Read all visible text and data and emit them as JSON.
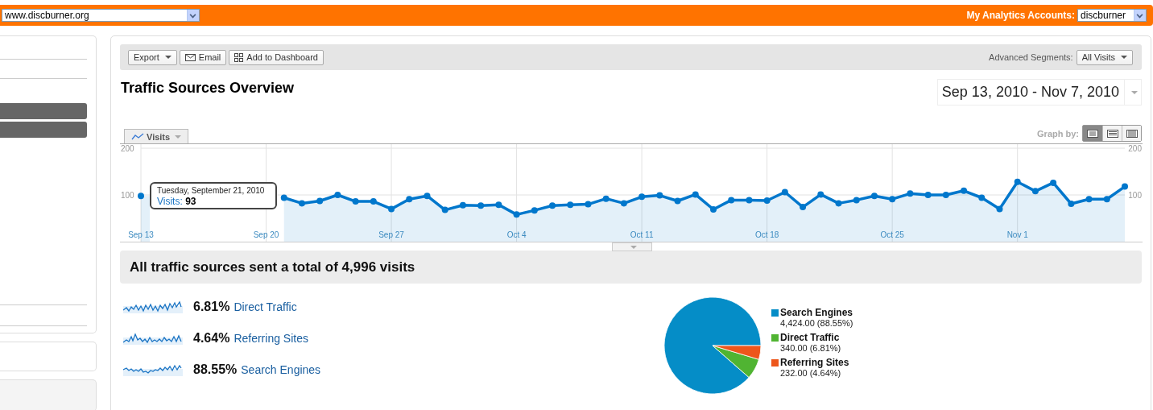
{
  "header": {
    "site_select": "www.discburner.org",
    "accounts_label": "My Analytics Accounts:",
    "account_select": "discburner"
  },
  "toolbar": {
    "buttons": [
      {
        "kind": "export",
        "label": "Export"
      },
      {
        "kind": "email",
        "label": "Email"
      },
      {
        "kind": "dashboard",
        "label": "Add to Dashboard"
      }
    ],
    "segments_label": "Advanced Segments:",
    "segments_select": "All Visits"
  },
  "title": "Traffic Sources Overview",
  "date_range": "Sep 13, 2010 - Nov 7, 2010",
  "graph": {
    "graph_by_label": "Graph by:",
    "graph_by": [
      {
        "selected": true
      },
      {
        "selected": false
      },
      {
        "selected": false
      }
    ],
    "tooltip": {
      "date": "Tuesday, September 21, 2010",
      "label": "Visits:",
      "value": "93"
    },
    "right_ticks": [
      "200",
      "100"
    ],
    "chart_data": {
      "type": "area",
      "categories": [
        "Sep 13",
        null,
        null,
        null,
        null,
        null,
        null,
        "Sep 20",
        null,
        null,
        null,
        null,
        null,
        null,
        "Sep 27",
        null,
        null,
        null,
        null,
        null,
        null,
        "Oct 4",
        null,
        null,
        null,
        null,
        null,
        null,
        "Oct 11",
        null,
        null,
        null,
        null,
        null,
        null,
        "Oct 18",
        null,
        null,
        null,
        null,
        null,
        null,
        "Oct 25",
        null,
        null,
        null,
        null,
        null,
        null,
        "Nov 1",
        null,
        null,
        null,
        null,
        null,
        null
      ],
      "series": [
        {
          "name": "Visits",
          "color": "#0077cc",
          "values": [
            98,
            null,
            null,
            null,
            null,
            null,
            null,
            null,
            94,
            82,
            87,
            100,
            86,
            86,
            70,
            91,
            98,
            68,
            78,
            77,
            79,
            58,
            67,
            77,
            79,
            80,
            92,
            82,
            96,
            99,
            87,
            101,
            69,
            89,
            89,
            88,
            106,
            74,
            101,
            82,
            89,
            98,
            91,
            103,
            100,
            100,
            109,
            94,
            70,
            128,
            108,
            126,
            81,
            91,
            91,
            118
          ]
        }
      ],
      "ylim": [
        0,
        200
      ],
      "yticks": [
        100,
        200
      ],
      "grid": true
    }
  },
  "summary": "All traffic sources sent a total of 4,996 visits",
  "sources": [
    {
      "percent": "6.81%",
      "name": "Direct Traffic"
    },
    {
      "percent": "4.64%",
      "name": "Referring Sites"
    },
    {
      "percent": "88.55%",
      "name": "Search Engines"
    }
  ],
  "pie": {
    "chart_data": {
      "type": "pie",
      "categories": [
        "Search Engines",
        "Direct Traffic",
        "Referring Sites"
      ],
      "values": [
        88.55,
        6.81,
        4.64
      ],
      "value_labels": [
        "4,424.00 (88.55%)",
        "340.00 (6.81%)",
        "232.00 (4.64%)"
      ]
    },
    "legend": [
      {
        "color": "#058dc7"
      },
      {
        "color": "#50b432"
      },
      {
        "color": "#ed561b"
      }
    ]
  }
}
